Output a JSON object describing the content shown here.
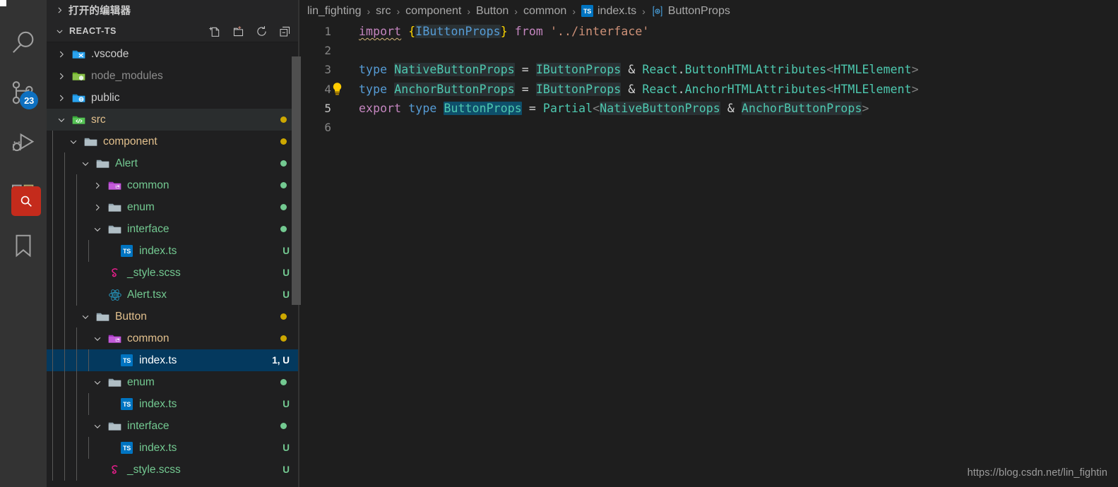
{
  "activity_bar": {
    "items": [
      {
        "name": "search-icon",
        "label": "Search",
        "badge": null
      },
      {
        "name": "source-control-icon",
        "label": "Source Control",
        "badge": "23"
      },
      {
        "name": "run-debug-icon",
        "label": "Run and Debug",
        "badge": null
      },
      {
        "name": "extensions-icon",
        "label": "Extensions",
        "badge": ""
      },
      {
        "name": "bookmarks-icon",
        "label": "Bookmarks",
        "badge": null
      }
    ],
    "badge_color": "#0e70c0",
    "extensions_badge_color": "#c42b1c"
  },
  "sidebar": {
    "open_editors_label": "打开的编辑器",
    "workspace_label": "REACT-TS",
    "actions": [
      {
        "name": "new-file-icon",
        "label": "New File"
      },
      {
        "name": "new-folder-icon",
        "label": "New Folder"
      },
      {
        "name": "refresh-icon",
        "label": "Refresh Explorer"
      },
      {
        "name": "collapse-all-icon",
        "label": "Collapse Folders in Explorer"
      }
    ],
    "tree": [
      {
        "label": ".vscode",
        "depth": 1,
        "type": "folder",
        "twisty": "right",
        "icon": "vscode-folder-icon",
        "color": "#cccccc",
        "deco": "",
        "deco_color": "",
        "state": "normal"
      },
      {
        "label": "node_modules",
        "depth": 1,
        "type": "folder",
        "twisty": "right",
        "icon": "node-folder-icon",
        "color": "#8c8c8c",
        "deco": "",
        "deco_color": "",
        "state": "normal"
      },
      {
        "label": "public",
        "depth": 1,
        "type": "folder",
        "twisty": "right",
        "icon": "public-folder-icon",
        "color": "#cccccc",
        "deco": "",
        "deco_color": "",
        "state": "normal"
      },
      {
        "label": "src",
        "depth": 1,
        "type": "folder",
        "twisty": "down",
        "icon": "src-folder-icon",
        "color": "#e2c08d",
        "deco": "dot",
        "deco_color": "#cca700",
        "state": "hovered"
      },
      {
        "label": "component",
        "depth": 2,
        "type": "folder",
        "twisty": "down",
        "icon": "folder-icon",
        "color": "#e2c08d",
        "deco": "dot",
        "deco_color": "#cca700",
        "state": "normal"
      },
      {
        "label": "Alert",
        "depth": 3,
        "type": "folder",
        "twisty": "down",
        "icon": "folder-icon",
        "color": "#73c991",
        "deco": "dot",
        "deco_color": "#73c991",
        "state": "normal"
      },
      {
        "label": "common",
        "depth": 4,
        "type": "folder",
        "twisty": "right",
        "icon": "component-folder-icon",
        "color": "#73c991",
        "deco": "dot",
        "deco_color": "#73c991",
        "state": "normal"
      },
      {
        "label": "enum",
        "depth": 4,
        "type": "folder",
        "twisty": "right",
        "icon": "folder-icon",
        "color": "#73c991",
        "deco": "dot",
        "deco_color": "#73c991",
        "state": "normal"
      },
      {
        "label": "interface",
        "depth": 4,
        "type": "folder",
        "twisty": "down",
        "icon": "folder-icon",
        "color": "#73c991",
        "deco": "dot",
        "deco_color": "#73c991",
        "state": "normal"
      },
      {
        "label": "index.ts",
        "depth": 5,
        "type": "file",
        "twisty": "none",
        "icon": "typescript-file-icon",
        "color": "#73c991",
        "deco": "U",
        "deco_color": "#73c991",
        "state": "normal"
      },
      {
        "label": "_style.scss",
        "depth": 4,
        "type": "file",
        "twisty": "none",
        "icon": "sass-file-icon",
        "color": "#73c991",
        "deco": "U",
        "deco_color": "#73c991",
        "state": "normal"
      },
      {
        "label": "Alert.tsx",
        "depth": 4,
        "type": "file",
        "twisty": "none",
        "icon": "react-file-icon",
        "color": "#73c991",
        "deco": "U",
        "deco_color": "#73c991",
        "state": "normal"
      },
      {
        "label": "Button",
        "depth": 3,
        "type": "folder",
        "twisty": "down",
        "icon": "folder-icon",
        "color": "#e2c08d",
        "deco": "dot",
        "deco_color": "#cca700",
        "state": "normal"
      },
      {
        "label": "common",
        "depth": 4,
        "type": "folder",
        "twisty": "down",
        "icon": "component-folder-icon",
        "color": "#e2c08d",
        "deco": "dot",
        "deco_color": "#cca700",
        "state": "normal"
      },
      {
        "label": "index.ts",
        "depth": 5,
        "type": "file",
        "twisty": "none",
        "icon": "typescript-file-icon",
        "color": "#ffffff",
        "deco": "1, U",
        "deco_color": "#ffffff",
        "state": "selected"
      },
      {
        "label": "enum",
        "depth": 4,
        "type": "folder",
        "twisty": "down",
        "icon": "folder-icon",
        "color": "#73c991",
        "deco": "dot",
        "deco_color": "#73c991",
        "state": "normal"
      },
      {
        "label": "index.ts",
        "depth": 5,
        "type": "file",
        "twisty": "none",
        "icon": "typescript-file-icon",
        "color": "#73c991",
        "deco": "U",
        "deco_color": "#73c991",
        "state": "normal"
      },
      {
        "label": "interface",
        "depth": 4,
        "type": "folder",
        "twisty": "down",
        "icon": "folder-icon",
        "color": "#73c991",
        "deco": "dot",
        "deco_color": "#73c991",
        "state": "normal"
      },
      {
        "label": "index.ts",
        "depth": 5,
        "type": "file",
        "twisty": "none",
        "icon": "typescript-file-icon",
        "color": "#73c991",
        "deco": "U",
        "deco_color": "#73c991",
        "state": "normal"
      },
      {
        "label": "_style.scss",
        "depth": 4,
        "type": "file",
        "twisty": "none",
        "icon": "sass-file-icon",
        "color": "#73c991",
        "deco": "U",
        "deco_color": "#73c991",
        "state": "normal"
      }
    ]
  },
  "editor": {
    "breadcrumb": [
      {
        "label": "lin_fighting",
        "icon": null
      },
      {
        "label": "src",
        "icon": null
      },
      {
        "label": "component",
        "icon": null
      },
      {
        "label": "Button",
        "icon": null
      },
      {
        "label": "common",
        "icon": null
      },
      {
        "label": "index.ts",
        "icon": "typescript-file-icon"
      },
      {
        "label": "ButtonProps",
        "icon": "symbol-interface-icon"
      }
    ],
    "separator": "›",
    "current_line": 5,
    "lines": [
      {
        "no": "1",
        "tokens": [
          {
            "t": "import",
            "c": "t-kw",
            "squiggle": true
          },
          {
            "t": " ",
            "c": "t-plain"
          },
          {
            "t": "{",
            "c": "t-brace"
          },
          {
            "t": "IButtonProps",
            "c": "t-kw2",
            "hl": "occ"
          },
          {
            "t": "}",
            "c": "t-brace"
          },
          {
            "t": " ",
            "c": "t-plain"
          },
          {
            "t": "from",
            "c": "t-kw"
          },
          {
            "t": " ",
            "c": "t-plain"
          },
          {
            "t": "'../interface'",
            "c": "t-str"
          }
        ]
      },
      {
        "no": "2",
        "tokens": []
      },
      {
        "no": "3",
        "tokens": [
          {
            "t": "type",
            "c": "t-kw2"
          },
          {
            "t": " ",
            "c": "t-plain"
          },
          {
            "t": "NativeButtonProps",
            "c": "t-type",
            "hl": "occ"
          },
          {
            "t": " = ",
            "c": "t-op"
          },
          {
            "t": "IButtonProps",
            "c": "t-type",
            "hl": "occ"
          },
          {
            "t": " & ",
            "c": "t-op"
          },
          {
            "t": "React",
            "c": "t-type"
          },
          {
            "t": ".",
            "c": "t-plain"
          },
          {
            "t": "ButtonHTMLAttributes",
            "c": "t-type"
          },
          {
            "t": "<",
            "c": "t-ang"
          },
          {
            "t": "HTMLElement",
            "c": "t-type"
          },
          {
            "t": ">",
            "c": "t-ang"
          }
        ]
      },
      {
        "no": "4",
        "bulb": true,
        "tokens": [
          {
            "t": "type",
            "c": "t-kw2"
          },
          {
            "t": " ",
            "c": "t-plain"
          },
          {
            "t": "AnchorButtonProps",
            "c": "t-type",
            "hl": "occ"
          },
          {
            "t": " = ",
            "c": "t-op"
          },
          {
            "t": "IButtonProps",
            "c": "t-type",
            "hl": "occ"
          },
          {
            "t": " & ",
            "c": "t-op"
          },
          {
            "t": "React",
            "c": "t-type"
          },
          {
            "t": ".",
            "c": "t-plain"
          },
          {
            "t": "AnchorHTMLAttributes",
            "c": "t-type"
          },
          {
            "t": "<",
            "c": "t-ang"
          },
          {
            "t": "HTMLElement",
            "c": "t-type"
          },
          {
            "t": ">",
            "c": "t-ang"
          }
        ]
      },
      {
        "no": "5",
        "tokens": [
          {
            "t": "export",
            "c": "t-kw"
          },
          {
            "t": " ",
            "c": "t-plain"
          },
          {
            "t": "type",
            "c": "t-kw2"
          },
          {
            "t": " ",
            "c": "t-plain"
          },
          {
            "t": "ButtonProps",
            "c": "t-type",
            "hl": "sel"
          },
          {
            "t": " = ",
            "c": "t-op"
          },
          {
            "t": "Partial",
            "c": "t-type"
          },
          {
            "t": "<",
            "c": "t-ang"
          },
          {
            "t": "NativeButtonProps",
            "c": "t-type",
            "hl": "occ"
          },
          {
            "t": " & ",
            "c": "t-op"
          },
          {
            "t": "AnchorButtonProps",
            "c": "t-type",
            "hl": "occ"
          },
          {
            "t": ">",
            "c": "t-ang"
          }
        ]
      },
      {
        "no": "6",
        "tokens": []
      }
    ]
  },
  "watermark": "https://blog.csdn.net/lin_fightin"
}
